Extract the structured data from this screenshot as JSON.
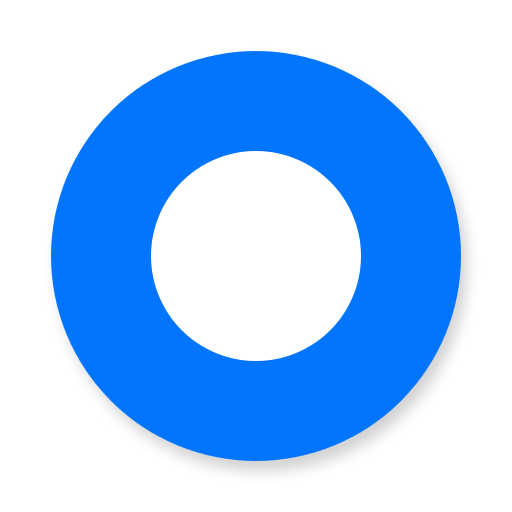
{
  "icon": {
    "name": "ring-icon",
    "ring_color": "#0275FF",
    "hole_color": "#FFFFFF",
    "background_color": "#FFFFFF"
  }
}
